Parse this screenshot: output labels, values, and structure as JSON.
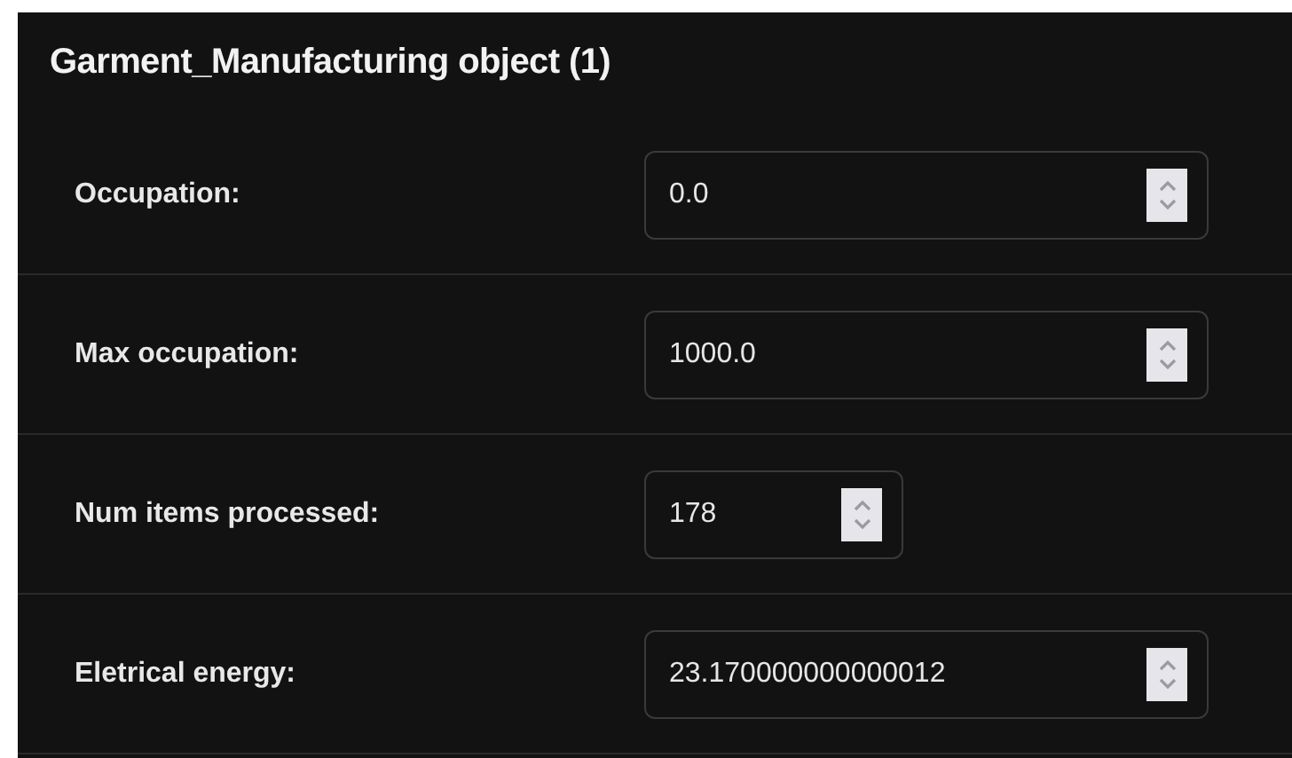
{
  "panel": {
    "title": "Garment_Manufacturing object (1)"
  },
  "fields": [
    {
      "label": "Occupation:",
      "value": "0.0",
      "kind": "float"
    },
    {
      "label": "Max occupation:",
      "value": "1000.0",
      "kind": "float"
    },
    {
      "label": "Num items processed:",
      "value": "178",
      "kind": "integer"
    },
    {
      "label": "Eletrical energy:",
      "value": "23.170000000000012",
      "kind": "float"
    }
  ]
}
